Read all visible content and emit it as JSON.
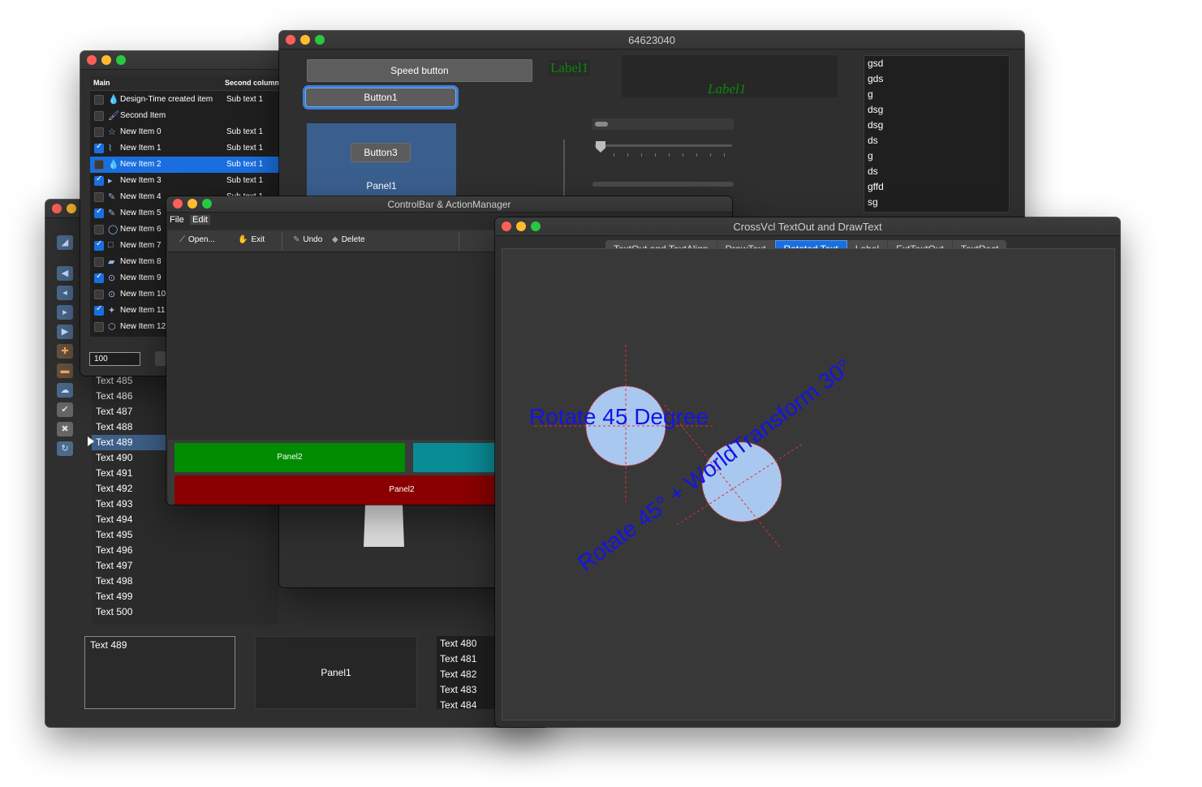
{
  "win_left": {
    "listbox_rows": [
      "Text 485",
      "Text 486",
      "Text 487",
      "Text 488",
      "Text 489",
      "Text 490",
      "Text 491",
      "Text 492",
      "Text 493",
      "Text 494",
      "Text 495",
      "Text 496",
      "Text 497",
      "Text 498",
      "Text 499",
      "Text 500"
    ],
    "selected_row": "Text 489",
    "memo_text": "Text 489",
    "panel1_label": "Panel1",
    "small_list": [
      "Text 480",
      "Text 481",
      "Text 482",
      "Text 483",
      "Text 484"
    ]
  },
  "win_tree": {
    "col_main": "Main",
    "col_second": "Second column",
    "rows": [
      {
        "name": "Design-Time created item",
        "sub": "Sub text 1",
        "checked": false,
        "icon": "drop-icon"
      },
      {
        "name": "Second Item",
        "sub": "",
        "checked": false,
        "icon": "brush-icon"
      },
      {
        "name": "New Item 0",
        "sub": "Sub text 1",
        "checked": false,
        "icon": "star-icon"
      },
      {
        "name": "New Item 1",
        "sub": "Sub text 1",
        "checked": true,
        "icon": "path-icon"
      },
      {
        "name": "New Item 2",
        "sub": "Sub text 1",
        "checked": false,
        "icon": "drop-icon"
      },
      {
        "name": "New Item 3",
        "sub": "Sub text 1",
        "checked": true,
        "icon": "play-icon"
      },
      {
        "name": "New Item 4",
        "sub": "Sub text 1",
        "checked": false,
        "icon": "pen-icon"
      },
      {
        "name": "New Item 5",
        "sub": "",
        "checked": true,
        "icon": "pen-icon"
      },
      {
        "name": "New Item 6",
        "sub": "",
        "checked": false,
        "icon": "circle-icon"
      },
      {
        "name": "New Item 7",
        "sub": "",
        "checked": true,
        "icon": "square-icon"
      },
      {
        "name": "New Item 8",
        "sub": "",
        "checked": false,
        "icon": "eraser-icon"
      },
      {
        "name": "New Item 9",
        "sub": "",
        "checked": true,
        "icon": "lasso-icon"
      },
      {
        "name": "New Item 10",
        "sub": "",
        "checked": false,
        "icon": "lasso-icon"
      },
      {
        "name": "New Item 11",
        "sub": "",
        "checked": true,
        "icon": "star-filled-icon"
      },
      {
        "name": "New Item 12",
        "sub": "",
        "checked": false,
        "icon": "shape-icon"
      }
    ],
    "selected_index": 4,
    "edit_value": "100"
  },
  "win_main": {
    "title": "64623040",
    "speed_button": "Speed button",
    "button1": "Button1",
    "button3": "Button3",
    "panel1": "Panel1",
    "label1_a": "Label1",
    "label1_b": "Label1",
    "listbox": [
      "gsd",
      "gds",
      "g",
      "dsg",
      "dsg",
      "ds",
      "g",
      "ds",
      "gffd",
      "sg"
    ]
  },
  "win_controlbar": {
    "title": "ControlBar & ActionManager",
    "menu_file": "File",
    "menu_edit": "Edit",
    "tb_open": "Open...",
    "tb_exit": "Exit",
    "tb_undo": "Undo",
    "tb_delete": "Delete",
    "panel2_green": "Panel2",
    "panel2_red": "Panel2"
  },
  "win_crossvcl": {
    "title": "CrossVcl TextOut and DrawText",
    "tabs": [
      "TextOut and TextAlign",
      "DrawText",
      "Rotated Text",
      "Label",
      "ExtTextOut",
      "TextRect"
    ],
    "selected_tab": "Rotated Text",
    "text_rotate45": "Rotate 45 Degree",
    "text_worldtransform": "Rotate 45° + WorldTransform 30°"
  },
  "colors": {
    "accent": "#1a6fe0",
    "rotated_text": "#1414e6",
    "circle_fill": "#a9c8f0",
    "guide_red": "#e23030",
    "panel_green": "#008c00",
    "panel_red": "#8a0000",
    "panel_teal": "#0a8c96"
  }
}
